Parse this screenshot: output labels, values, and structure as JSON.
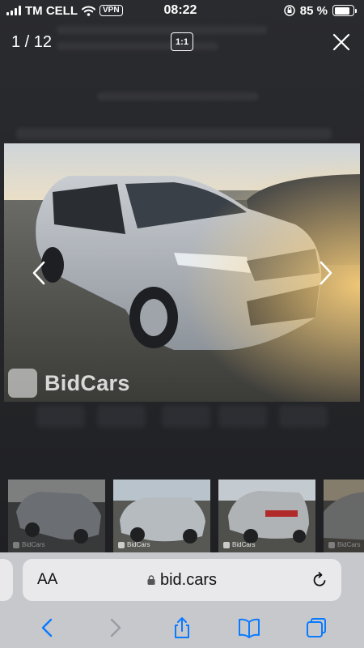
{
  "status_bar": {
    "carrier": "TM CELL",
    "vpn": "VPN",
    "time": "08:22",
    "battery": "85 %",
    "battery_level": 0.85
  },
  "gallery": {
    "counter": "1 / 12",
    "scale_button": "1:1",
    "watermark": "BidCars",
    "thumbnails": [
      {
        "watermark": "BidCars"
      },
      {
        "watermark": "BidCars"
      },
      {
        "watermark": "BidCars"
      },
      {
        "watermark": "BidCars"
      }
    ]
  },
  "browser": {
    "text_size_label": "AA",
    "url": "bid.cars"
  },
  "icons": {
    "signal": "signal-icon",
    "wifi": "wifi-icon",
    "orientation_lock": "orientation-lock-icon",
    "battery": "battery-icon",
    "close": "close-icon",
    "prev": "chevron-left-icon",
    "next": "chevron-right-icon",
    "lock": "lock-icon",
    "reload": "reload-icon",
    "back": "back-icon",
    "forward": "forward-icon",
    "share": "share-icon",
    "bookmarks": "bookmarks-icon",
    "tabs": "tabs-icon"
  },
  "colors": {
    "overlay_bg": "#1c1c1e",
    "safari_bar": "#c7c8cc",
    "accent": "#0a7aff"
  }
}
